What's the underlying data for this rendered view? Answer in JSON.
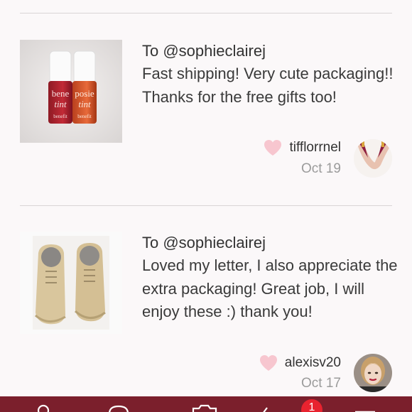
{
  "reviews": [
    {
      "to": "To @sophieclairej",
      "text": "Fast shipping! Very cute packaging!! Thanks for the free gifts too!",
      "username": "tifflorrnel",
      "date": "Oct 19",
      "thumb_labels": [
        "bene",
        "tint",
        "posie",
        "tint",
        "benefit",
        "benefit"
      ]
    },
    {
      "to": "To @sophieclairej",
      "text": "Loved my letter, I also appreciate the extra packaging! Great job, I will enjoy these :) thank you!",
      "username": "alexisv20",
      "date": "Oct 17"
    }
  ],
  "nav": {
    "badge": "1"
  },
  "colors": {
    "heart": "#f7c6cf",
    "nav_bar": "#7b1f2c",
    "badge": "#e8232f"
  },
  "icons": [
    "heart-icon",
    "shop-icon",
    "comment-icon",
    "camera-icon",
    "news-icon",
    "menu-icon"
  ]
}
